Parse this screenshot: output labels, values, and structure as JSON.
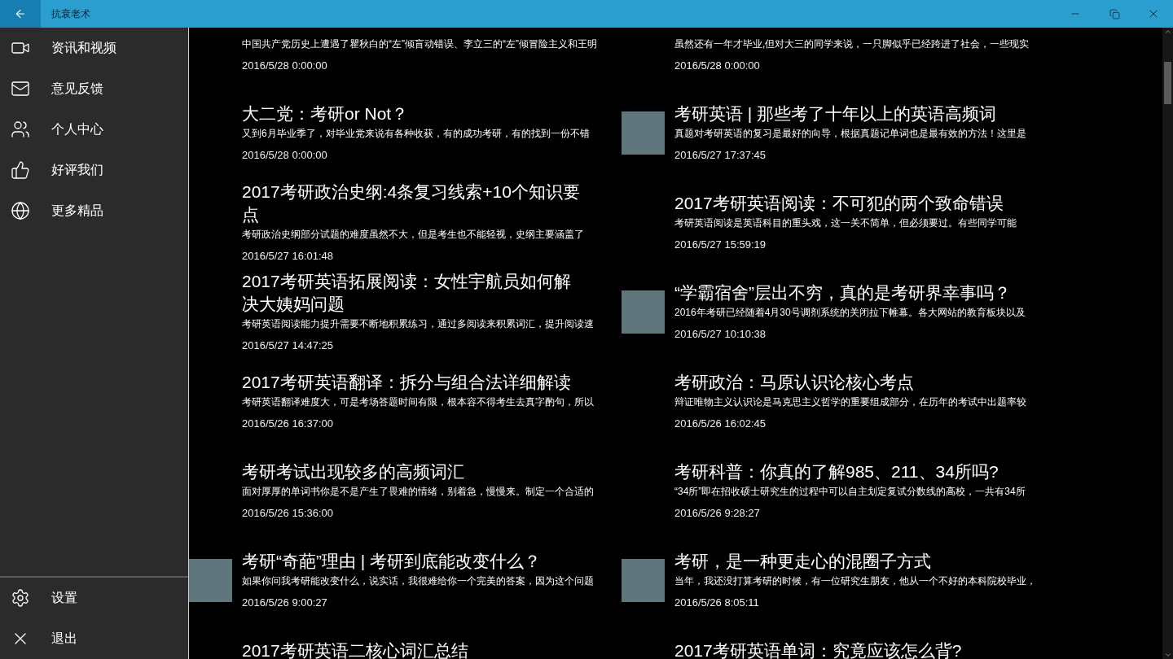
{
  "window": {
    "title": "抗衰老术"
  },
  "sidebar": {
    "items": [
      {
        "label": "资讯和视频"
      },
      {
        "label": "意见反馈"
      },
      {
        "label": "个人中心"
      },
      {
        "label": "好评我们"
      },
      {
        "label": "更多精品"
      }
    ],
    "footer_items": [
      {
        "label": "设置"
      },
      {
        "label": "退出"
      }
    ]
  },
  "articles": [
    {
      "summary": "中国共产党历史上遭遇了瞿秋白的“左”倾盲动错误、李立三的“左”倾冒险主义和王明",
      "date": "2016/5/28 0:00:00",
      "thumbnail": false
    },
    {
      "summary": "虽然还有一年才毕业,但对大三的同学来说，一只脚似乎已经跨进了社会，一些现实",
      "date": "2016/5/28 0:00:00",
      "thumbnail": false
    },
    {
      "title": "大二党：考研or Not？",
      "summary": "又到6月毕业季了，对毕业党来说有各种收获，有的成功考研，有的找到一份不错",
      "date": "2016/5/28 0:00:00",
      "thumbnail": false
    },
    {
      "title": "考研英语 | 那些考了十年以上的英语高频词",
      "summary": "真题对考研英语的复习是最好的向导，根据真题记单词也是最有效的方法！这里是",
      "date": "2016/5/27 17:37:45",
      "thumbnail": true
    },
    {
      "title": "2017考研政治史纲:4条复习线索+10个知识要点",
      "summary": "考研政治史纲部分试题的难度虽然不大，但是考生也不能轻视，史纲主要涵盖了",
      "date": "2016/5/27 16:01:48",
      "thumbnail": false
    },
    {
      "title": "2017考研英语阅读：不可犯的两个致命错误",
      "summary": "考研英语阅读是英语科目的重头戏，这一关不简单，但必须要过。有些同学可能",
      "date": "2016/5/27 15:59:19",
      "thumbnail": false
    },
    {
      "title": "2017考研英语拓展阅读：女性宇航员如何解决大姨妈问题",
      "summary": "考研英语阅读能力提升需要不断地积累练习，通过多阅读来积累词汇，提升阅读速",
      "date": "2016/5/27 14:47:25",
      "thumbnail": false
    },
    {
      "title": "“学霸宿舍”层出不穷，真的是考研界幸事吗？",
      "summary": "2016年考研已经随着4月30号调剂系统的关闭拉下帷幕。各大网站的教育板块以及",
      "date": "2016/5/27 10:10:38",
      "thumbnail": true
    },
    {
      "title": "2017考研英语翻译：拆分与组合法详细解读",
      "summary": "考研英语翻译难度大，可是考场答题时间有限，根本容不得考生去真字酌句，所以",
      "date": "2016/5/26 16:37:00",
      "thumbnail": false
    },
    {
      "title": "考研政治：马原认识论核心考点",
      "summary": "辩证唯物主义认识论是马克思主义哲学的重要组成部分，在历年的考试中出题率较",
      "date": "2016/5/26 16:02:45",
      "thumbnail": false
    },
    {
      "title": "考研考试出现较多的高频词汇",
      "summary": "面对厚厚的单词书你是不是产生了畏难的情绪，别着急，慢慢来。制定一个合适的",
      "date": "2016/5/26 15:36:00",
      "thumbnail": false
    },
    {
      "title": "考研科普：你真的了解985、211、34所吗?",
      "summary": "“34所”即在招收硕士研究生的过程中可以自主划定复试分数线的高校，一共有34所",
      "date": "2016/5/26 9:28:27",
      "thumbnail": false
    },
    {
      "title": "考研“奇葩”理由 | 考研到底能改变什么？",
      "summary": "如果你问我考研能改变什么，说实话，我很难给你一个完美的答案，因为这个问题",
      "date": "2016/5/26 9:00:27",
      "thumbnail": true
    },
    {
      "title": "考研，是一种更走心的混圈子方式",
      "summary": "当年，我还没打算考研的时候，有一位研究生朋友，他从一个不好的本科院校毕业，",
      "date": "2016/5/26 8:05:11",
      "thumbnail": true
    },
    {
      "title": "2017考研英语二核心词汇总结",
      "thumbnail": false
    },
    {
      "title": "2017考研英语单词：究竟应该怎么背?",
      "thumbnail": false
    }
  ]
}
